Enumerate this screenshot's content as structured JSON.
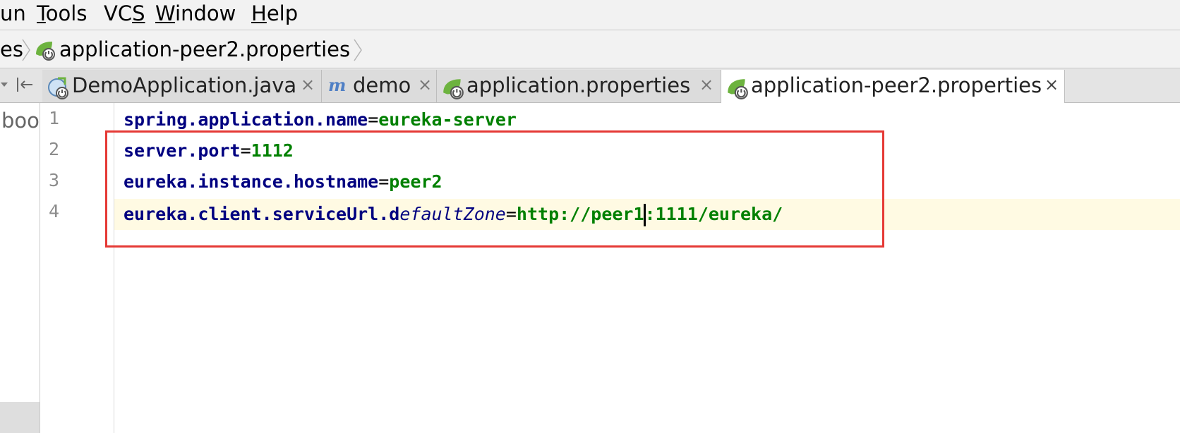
{
  "menu": {
    "items": [
      {
        "pre": "",
        "mn": "",
        "post": "un"
      },
      {
        "pre": "",
        "mn": "T",
        "post": "ools"
      },
      {
        "pre": "VC",
        "mn": "S",
        "post": ""
      },
      {
        "pre": "",
        "mn": "W",
        "post": "indow"
      },
      {
        "pre": "",
        "mn": "H",
        "post": "elp"
      }
    ]
  },
  "breadcrumb": {
    "partial": "es",
    "file": "application-peer2.properties"
  },
  "tabs": [
    {
      "label": "DemoApplication.java",
      "close": "×"
    },
    {
      "label": "demo",
      "close": "×"
    },
    {
      "label": "application.properties",
      "close": "×"
    },
    {
      "label": "application-peer2.properties",
      "close": "×",
      "active": true
    }
  ],
  "project_strip": {
    "text": "boo"
  },
  "editor": {
    "line_numbers": [
      "1",
      "2",
      "3",
      "4"
    ],
    "lines": [
      {
        "key": "spring.application.name",
        "eq": "=",
        "value": "eureka-server"
      },
      {
        "key": "server.port",
        "eq": "=",
        "value": "1112"
      },
      {
        "key": "eureka.instance.hostname",
        "eq": "=",
        "value": "peer2"
      },
      {
        "key_a": "eureka.client.serviceUrl.d",
        "key_b": "efaultZone",
        "eq": "=",
        "value_a": "http://peer1",
        "value_b": ":1111/eureka/"
      }
    ]
  },
  "colors": {
    "key": "#000080",
    "value": "#008000",
    "caret_line": "#fffae3",
    "annotation_box": "#e53935"
  }
}
